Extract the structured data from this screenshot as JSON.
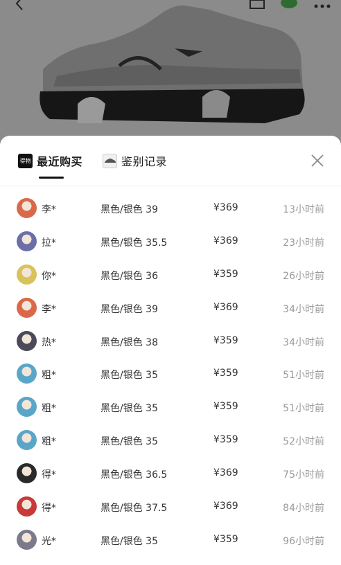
{
  "tabs": {
    "recent": {
      "label": "最近购买",
      "icon": "dewu-logo-icon",
      "icon_text": "得物"
    },
    "auth": {
      "label": "鉴别记录",
      "icon": "sneaker-thumbnail-icon"
    }
  },
  "colors": {
    "accent": "#111111",
    "muted": "#9a9a9a",
    "text": "#333333"
  },
  "records": [
    {
      "buyer": "李*",
      "spec": "黑色/银色 39",
      "price": "¥369",
      "time": "13小时前",
      "avatar": "#d9694a"
    },
    {
      "buyer": "拉*",
      "spec": "黑色/银色 35.5",
      "price": "¥369",
      "time": "23小时前",
      "avatar": "#6b6fa8"
    },
    {
      "buyer": "你*",
      "spec": "黑色/银色 36",
      "price": "¥359",
      "time": "26小时前",
      "avatar": "#d8c25a"
    },
    {
      "buyer": "李*",
      "spec": "黑色/银色 39",
      "price": "¥369",
      "time": "34小时前",
      "avatar": "#d9694a"
    },
    {
      "buyer": "热*",
      "spec": "黑色/银色 38",
      "price": "¥359",
      "time": "34小时前",
      "avatar": "#4a4a5a"
    },
    {
      "buyer": "粗*",
      "spec": "黑色/银色 35",
      "price": "¥359",
      "time": "51小时前",
      "avatar": "#5aa6c8"
    },
    {
      "buyer": "粗*",
      "spec": "黑色/银色 35",
      "price": "¥359",
      "time": "51小时前",
      "avatar": "#5aa6c8"
    },
    {
      "buyer": "粗*",
      "spec": "黑色/银色 35",
      "price": "¥359",
      "time": "52小时前",
      "avatar": "#5aa6c8"
    },
    {
      "buyer": "得*",
      "spec": "黑色/银色 36.5",
      "price": "¥369",
      "time": "75小时前",
      "avatar": "#2a2a2a"
    },
    {
      "buyer": "得*",
      "spec": "黑色/银色 37.5",
      "price": "¥369",
      "time": "84小时前",
      "avatar": "#c83a3a"
    },
    {
      "buyer": "光*",
      "spec": "黑色/银色 35",
      "price": "¥359",
      "time": "96小时前",
      "avatar": "#7a7a8a"
    }
  ]
}
